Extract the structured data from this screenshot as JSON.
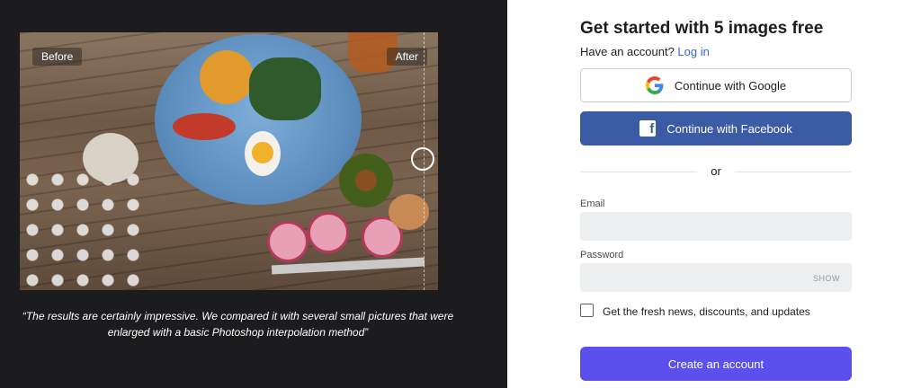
{
  "showcase": {
    "before_label": "Before",
    "after_label": "After",
    "quote": "“The results are certainly impressive. We compared it with several small pictures that were enlarged with a basic Photoshop interpolation method”"
  },
  "signup": {
    "title": "Get started with 5 images free",
    "have_account_text": "Have an account?",
    "login_link": "Log in",
    "google_button": "Continue with Google",
    "facebook_button": "Continue with Facebook",
    "or_text": "or",
    "email_label": "Email",
    "email_value": "",
    "password_label": "Password",
    "password_value": "",
    "show_label": "SHOW",
    "newsletter_label": "Get the fresh news, discounts, and updates",
    "newsletter_checked": false,
    "create_button": "Create an account"
  },
  "colors": {
    "left_panel_bg": "#1c1c1e",
    "facebook_blue": "#3b5ba5",
    "primary_button": "#5b50ee",
    "link_blue": "#2f6ad8"
  },
  "icons": [
    "google-icon",
    "facebook-icon",
    "slider-handle-icon"
  ]
}
